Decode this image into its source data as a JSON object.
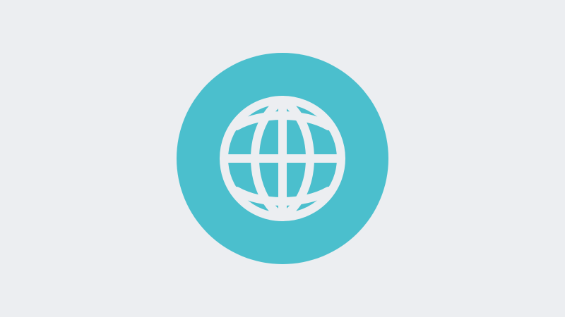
{
  "icon": {
    "name": "globe-icon",
    "badge_color": "#4bbfcd",
    "glyph_color": "#eceef1"
  },
  "page": {
    "background_color": "#eceef1"
  }
}
